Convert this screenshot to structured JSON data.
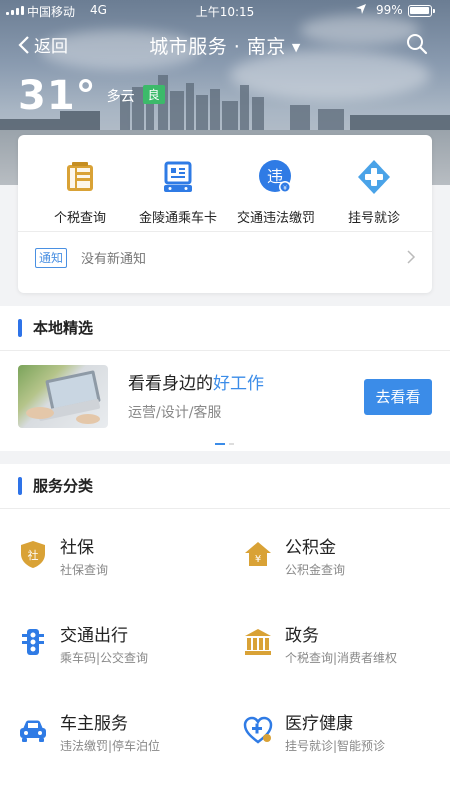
{
  "status_bar": {
    "carrier": "中国移动",
    "network": "4G",
    "time": "上午10:15",
    "battery": "99%"
  },
  "nav": {
    "back_label": "返回",
    "title": "城市服务 · 南京",
    "title_caret": "▼"
  },
  "weather": {
    "temperature": "31°",
    "condition": "多云",
    "aqi": "良"
  },
  "quick_services": [
    {
      "label": "个税查询",
      "icon": "tax-icon"
    },
    {
      "label": "金陵通乘车卡",
      "icon": "bus-card-icon"
    },
    {
      "label": "交通违法缴罚",
      "icon": "traffic-violation-icon"
    },
    {
      "label": "挂号就诊",
      "icon": "medical-cross-icon"
    }
  ],
  "notice": {
    "tag": "通知",
    "text": "没有新通知"
  },
  "local_picks": {
    "section_title": "本地精选",
    "headline_prefix": "看看身边的",
    "headline_highlight": "好工作",
    "subtitle": "运营/设计/客服",
    "button_label": "去看看"
  },
  "categories": {
    "section_title": "服务分类",
    "items": [
      {
        "name": "社保",
        "desc": "社保查询",
        "icon": "social-security-shield-icon"
      },
      {
        "name": "公积金",
        "desc": "公积金查询",
        "icon": "housing-fund-house-icon"
      },
      {
        "name": "交通出行",
        "desc": "乘车码|公交查询",
        "icon": "traffic-light-icon"
      },
      {
        "name": "政务",
        "desc": "个税查询|消费者维权",
        "icon": "government-building-icon"
      },
      {
        "name": "车主服务",
        "desc": "违法缴罚|停车泊位",
        "icon": "car-icon"
      },
      {
        "name": "医疗健康",
        "desc": "挂号就诊|智能预诊",
        "icon": "health-heart-icon"
      }
    ]
  },
  "colors": {
    "accent": "#3b8ce8",
    "section_bar": "#2e73e8",
    "aqi_good": "#3cba6a",
    "icon_gold": "#d9a236",
    "icon_blue": "#2f7be5"
  }
}
